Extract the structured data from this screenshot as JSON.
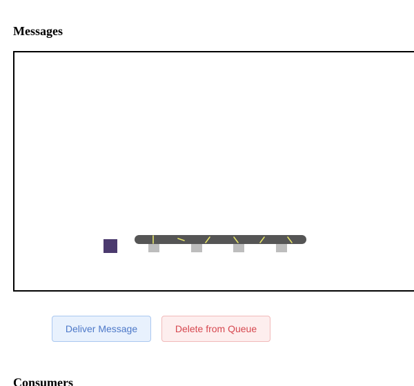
{
  "sections": {
    "messages_title": "Messages",
    "consumers_title": "Consumers"
  },
  "actions": {
    "deliver_label": "Deliver Message",
    "delete_label": "Delete from Queue"
  },
  "colors": {
    "message_block": "#4b3a6e",
    "conveyor_belt": "#555555",
    "conveyor_marks": "#e8e66a",
    "conveyor_feet": "#bdbdbd",
    "deliver_bg": "#e8f1fd",
    "delete_bg": "#fdeeee"
  }
}
